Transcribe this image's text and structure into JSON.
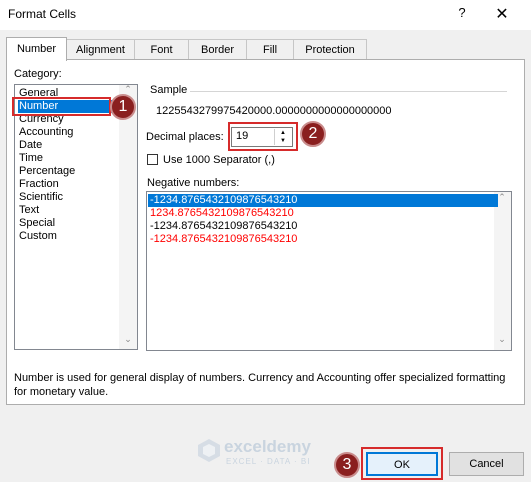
{
  "window": {
    "title": "Format Cells",
    "help_icon": "?",
    "close_icon": "✕"
  },
  "tabs": [
    "Number",
    "Alignment",
    "Font",
    "Border",
    "Fill",
    "Protection"
  ],
  "category": {
    "label": "Category:",
    "items": [
      "General",
      "Number",
      "Currency",
      "Accounting",
      "Date",
      "Time",
      "Percentage",
      "Fraction",
      "Scientific",
      "Text",
      "Special",
      "Custom"
    ],
    "selected": "Number"
  },
  "sample": {
    "label": "Sample",
    "value": "1225543279975420000.0000000000000000000"
  },
  "decimal_places": {
    "label": "Decimal places:",
    "value": "19"
  },
  "separator": {
    "label": "Use 1000 Separator (,)",
    "checked": false
  },
  "negative_numbers": {
    "label": "Negative numbers:",
    "items": [
      {
        "text": "-1234.8765432109876543210",
        "color": "#ffffff",
        "selected": true
      },
      {
        "text": "1234.8765432109876543210",
        "color": "#ff0000",
        "selected": false
      },
      {
        "text": "-1234.8765432109876543210",
        "color": "#000000",
        "selected": false
      },
      {
        "text": "-1234.8765432109876543210",
        "color": "#ff0000",
        "selected": false
      }
    ]
  },
  "description": "Number is used for general display of numbers.  Currency and Accounting offer specialized formatting for monetary value.",
  "callouts": [
    "1",
    "2",
    "3"
  ],
  "watermark": {
    "name": "exceldemy",
    "tagline": "EXCEL · DATA · BI"
  },
  "buttons": {
    "ok": "OK",
    "cancel": "Cancel"
  },
  "colors": {
    "selection": "#0078d7",
    "highlight": "#d62b2b",
    "callout": "#8a1f1f"
  }
}
